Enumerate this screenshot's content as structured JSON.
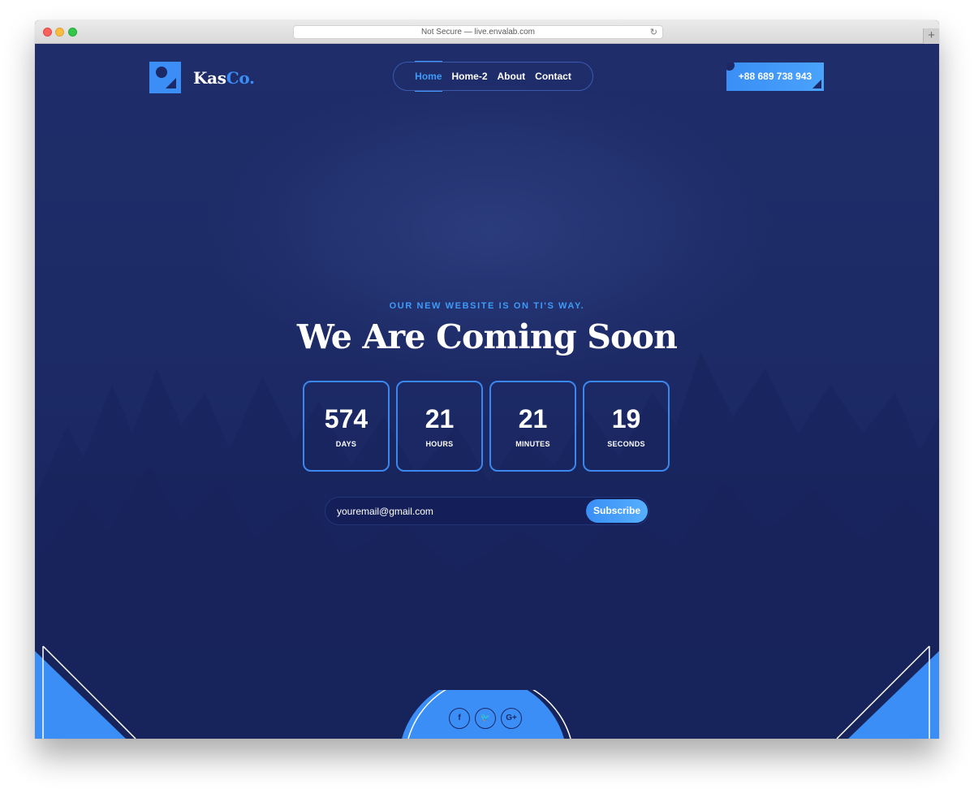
{
  "browser": {
    "url_text": "Not Secure — live.envalab.com",
    "reload_glyph": "↻",
    "newtab_glyph": "+"
  },
  "logo": {
    "text": "Kas",
    "accent": "Co."
  },
  "nav": {
    "items": [
      "Home",
      "Home-2",
      "About",
      "Contact"
    ]
  },
  "header": {
    "phone": "+88 689 738 943"
  },
  "hero": {
    "eyebrow": "OUR NEW WEBSITE IS ON TI'S WAY.",
    "title": "We Are Coming Soon"
  },
  "countdown": [
    {
      "value": "574",
      "label": "DAYS"
    },
    {
      "value": "21",
      "label": "HOURS"
    },
    {
      "value": "21",
      "label": "MINUTES"
    },
    {
      "value": "19",
      "label": "SECONDS"
    }
  ],
  "subscribe": {
    "email_value": "youremail@gmail.com",
    "button_label": "Subscribe"
  },
  "social": [
    {
      "icon": "facebook-icon",
      "glyph": "f"
    },
    {
      "icon": "twitter-icon",
      "glyph": "🐦"
    },
    {
      "icon": "google-plus-icon",
      "glyph": "G+"
    }
  ],
  "colors": {
    "background": "#1c2966",
    "accent": "#3a8ef5",
    "accent_light": "#3f9af8",
    "text": "#ffffff"
  }
}
